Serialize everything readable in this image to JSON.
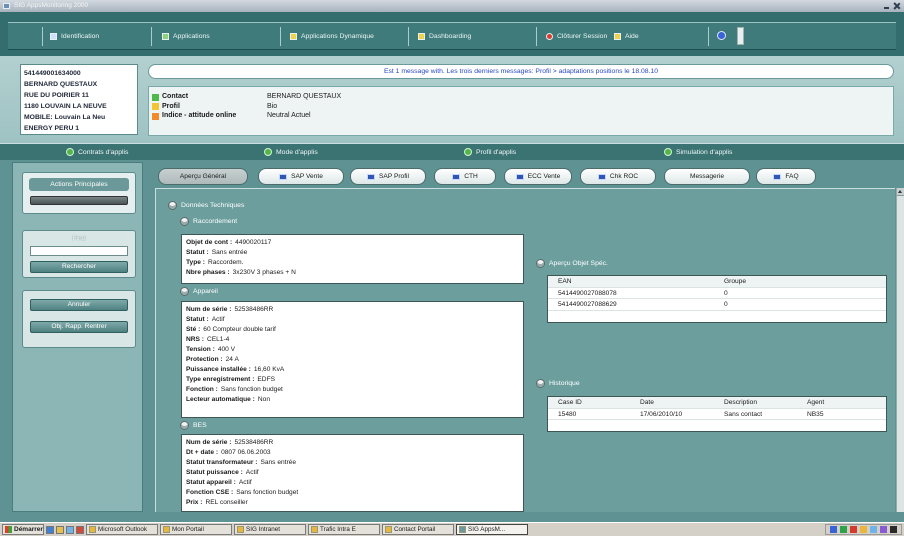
{
  "window": {
    "title": "SIG AppsMonitoring 2000"
  },
  "nav": {
    "items": [
      {
        "label": "Identification"
      },
      {
        "label": "Applications"
      },
      {
        "label": "Applications Dynamique"
      },
      {
        "label": "Dashboarding"
      },
      {
        "label": "Clôturer Session"
      },
      {
        "label": "Aide"
      }
    ]
  },
  "customer": {
    "lines": [
      "541449001634000",
      "BERNARD QUESTAUX",
      "RUE DU POIRIER 11",
      "1180 LOUVAIN LA NEUVE",
      "MOBILE: Louvain La Neu",
      "ENERGY PERU 1"
    ]
  },
  "banner": {
    "text": "Est 1 message with. Les trois derniers messages: Profil > adaptations positions le 18.08.10"
  },
  "info": {
    "rows": [
      {
        "label": "Contact",
        "value": "BERNARD QUESTAUX"
      },
      {
        "label": "Profil",
        "value": "Bio"
      },
      {
        "label": "Indice - attitude online",
        "value": "Neutral Actuel"
      }
    ]
  },
  "sections": {
    "items": [
      "Contrats d'applis",
      "Mode d'applis",
      "Profil d'applis",
      "Simulation d'applis"
    ]
  },
  "sidebar": {
    "actions_label": "Actions Principales",
    "find_label": "Find",
    "find_value": "",
    "search_button": "Rechercher",
    "cancel_button": "Annuler",
    "report_button": "Obj. Rapp. Rentrer"
  },
  "tabs": [
    {
      "label": "Aperçu Général",
      "selected": true
    },
    {
      "label": "SAP Vente"
    },
    {
      "label": "SAP Profil"
    },
    {
      "label": "CTH"
    },
    {
      "label": "ECC Vente"
    },
    {
      "label": "Chk ROC"
    },
    {
      "label": "Messagerie"
    },
    {
      "label": "FAQ"
    }
  ],
  "tech": {
    "title": "Données Techniques",
    "connection": {
      "title": "Raccordement",
      "rows": [
        {
          "label": "Objet de cont :",
          "value": "4490020117"
        },
        {
          "label": "Statut :",
          "value": "Sans entrée"
        },
        {
          "label": "Type :",
          "value": "Raccordem."
        },
        {
          "label": "Nbre phases :",
          "value": "3x230V 3 phases + N"
        }
      ]
    },
    "device": {
      "title": "Appareil",
      "rows": [
        {
          "label": "Num de série :",
          "value": "52538486RR"
        },
        {
          "label": "Statut :",
          "value": "Actif"
        },
        {
          "label": "Sté :",
          "value": "60 Compteur double tarif"
        },
        {
          "label": "NRS :",
          "value": "CEL1-4"
        },
        {
          "label": "Tension :",
          "value": "400 V"
        },
        {
          "label": "Protection :",
          "value": "24 A"
        },
        {
          "label": "Puissance installée :",
          "value": "16,60 KvA"
        },
        {
          "label": "Type enregistrement :",
          "value": "EDFS"
        },
        {
          "label": "Fonction :",
          "value": "Sans fonction budget"
        },
        {
          "label": "Lecteur automatique :",
          "value": "Non"
        }
      ]
    },
    "bes": {
      "title": "BES",
      "rows": [
        {
          "label": "Num de série :",
          "value": "52538486RR"
        },
        {
          "label": "Dt + date :",
          "value": "0807 06.06.2003"
        },
        {
          "label": "Statut transformateur :",
          "value": "Sans entrée"
        },
        {
          "label": "Statut puissance :",
          "value": "Actif"
        },
        {
          "label": "Statut appareil :",
          "value": "Actif"
        },
        {
          "label": "Fonction CSE :",
          "value": "Sans fonction budget"
        },
        {
          "label": "Prix :",
          "value": "REL conseiller"
        }
      ]
    }
  },
  "objects": {
    "title": "Aperçu Objet Spéc.",
    "columns": [
      "EAN",
      "Groupe"
    ],
    "rows": [
      [
        "5414490027088078",
        "0"
      ],
      [
        "5414490027088629",
        "0"
      ]
    ]
  },
  "history": {
    "title": "Historique",
    "columns": [
      "Case ID",
      "Date",
      "Description",
      "Agent"
    ],
    "rows": [
      [
        "15480",
        "17/06/2010/10",
        "Sans contact",
        "NB35"
      ]
    ]
  },
  "taskbar": {
    "start": "Démarrer",
    "items": [
      "Microsoft Outlook",
      "Mon Portail",
      "SIG Intranet",
      "Trafic Intra E",
      "Contact Portail",
      "SIG AppsM..."
    ]
  },
  "colors": {
    "teal_dark": "#336d6d",
    "teal_main": "#6c9e9e",
    "teal_light": "#a5c7c7",
    "link_blue": "#2747c4",
    "status_green": "#4fb84a",
    "status_yellow": "#f3c534",
    "status_orange": "#f08a2c"
  }
}
